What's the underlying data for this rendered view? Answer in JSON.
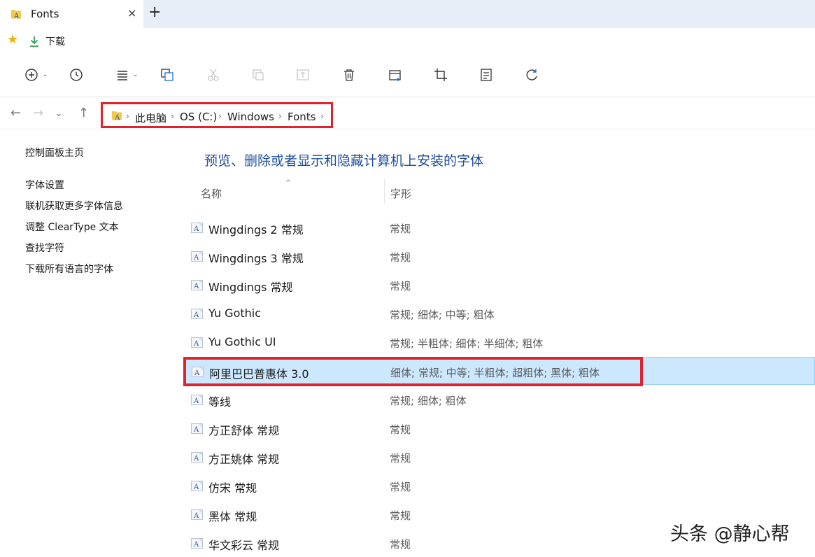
{
  "tab": {
    "title": "Fonts",
    "close": "×",
    "new": "+"
  },
  "favorites": {
    "items": [
      {
        "label": "下载",
        "icon": "download-icon"
      }
    ]
  },
  "toolbar": {
    "icons": [
      "new-icon",
      "recent-icon",
      "view-icon",
      "copy-icon",
      "cut-icon",
      "paste-icon",
      "rename-icon",
      "delete-icon",
      "layout-icon",
      "crop-icon",
      "properties-icon",
      "refresh-icon"
    ]
  },
  "address": {
    "crumbs": [
      {
        "label": "此电脑"
      },
      {
        "label": "OS (C:)"
      },
      {
        "label": "Windows"
      },
      {
        "label": "Fonts"
      }
    ]
  },
  "left_pane": {
    "links": [
      {
        "label": "控制面板主页"
      },
      {
        "label": "字体设置"
      },
      {
        "label": "联机获取更多字体信息"
      },
      {
        "label": "调整 ClearType 文本"
      },
      {
        "label": "查找字符"
      },
      {
        "label": "下载所有语言的字体"
      }
    ]
  },
  "main": {
    "title": "预览、删除或者显示和隐藏计算机上安装的字体",
    "columns": {
      "name": "名称",
      "style": "字形"
    },
    "rows": [
      {
        "name": "Wingdings 2 常规",
        "style": "常规"
      },
      {
        "name": "Wingdings 3 常规",
        "style": "常规"
      },
      {
        "name": "Wingdings 常规",
        "style": "常规"
      },
      {
        "name": "Yu Gothic",
        "style": "常规; 细体; 中等; 粗体"
      },
      {
        "name": "Yu Gothic UI",
        "style": "常规; 半粗体; 细体; 半细体; 粗体"
      },
      {
        "name": "阿里巴巴普惠体 3.0",
        "style": "细体; 常规; 中等; 半粗体; 超粗体; 黑体; 粗体",
        "selected": true
      },
      {
        "name": "等线",
        "style": "常规; 细体; 粗体"
      },
      {
        "name": "方正舒体 常规",
        "style": "常规"
      },
      {
        "name": "方正姚体 常规",
        "style": "常规"
      },
      {
        "name": "仿宋 常规",
        "style": "常规"
      },
      {
        "name": "黑体 常规",
        "style": "常规"
      },
      {
        "name": "华文彩云 常规",
        "style": "常规"
      }
    ]
  },
  "watermark": "头条 @静心帮",
  "colors": {
    "accent_title": "#1f4e9c",
    "selection": "#cce8ff",
    "highlight_box": "#e0232c"
  }
}
